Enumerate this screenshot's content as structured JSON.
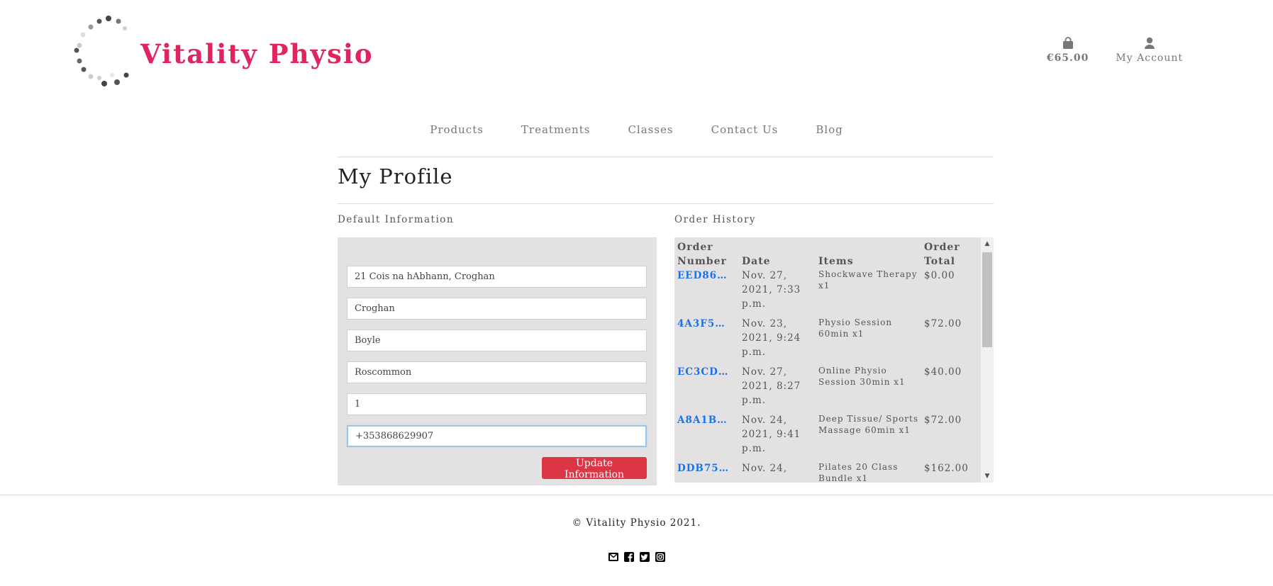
{
  "brand": {
    "name": "Vitality Physio",
    "color": "#e0245e"
  },
  "header": {
    "bag_label": "€65.00",
    "account_label": "My Account"
  },
  "nav": [
    "Products",
    "Treatments",
    "Classes",
    "Contact Us",
    "Blog"
  ],
  "page": {
    "title": "My Profile"
  },
  "default_info": {
    "label": "Default Information",
    "fields": [
      "21 Cois na hAbhann, Croghan",
      "Croghan",
      "Boyle",
      "Roscommon",
      "1",
      "+353868629907"
    ],
    "update_label": "Update Information",
    "button_color": "#dc3545"
  },
  "order_history": {
    "label": "Order History",
    "headers": {
      "number": "Order\nNumber",
      "date": "Date",
      "items": "Items",
      "total": "Order\nTotal"
    },
    "rows": [
      {
        "number": "EED86…",
        "date": "Nov. 27, 2021, 7:33 p.m.",
        "items": "Shockwave Therapy x1",
        "total": "$0.00"
      },
      {
        "number": "4A3F5…",
        "date": "Nov. 23, 2021, 9:24 p.m.",
        "items": "Physio Session 60min x1",
        "total": "$72.00"
      },
      {
        "number": "EC3CD…",
        "date": "Nov. 27, 2021, 8:27 p.m.",
        "items": "Online Physio Session 30min x1",
        "total": "$40.00"
      },
      {
        "number": "A8A1B…",
        "date": "Nov. 24, 2021, 9:41 p.m.",
        "items": "Deep Tissue/ Sports Massage 60min x1",
        "total": "$72.00"
      },
      {
        "number": "DDB75…",
        "date": "Nov. 24,",
        "items": "Pilates 20 Class Bundle x1",
        "total": "$162.00"
      }
    ],
    "link_color": "#1a73e8"
  },
  "footer": {
    "copyright": "© Vitality Physio 2021.",
    "icons": [
      "envelope-icon",
      "facebook-icon",
      "twitter-icon",
      "instagram-icon"
    ]
  }
}
